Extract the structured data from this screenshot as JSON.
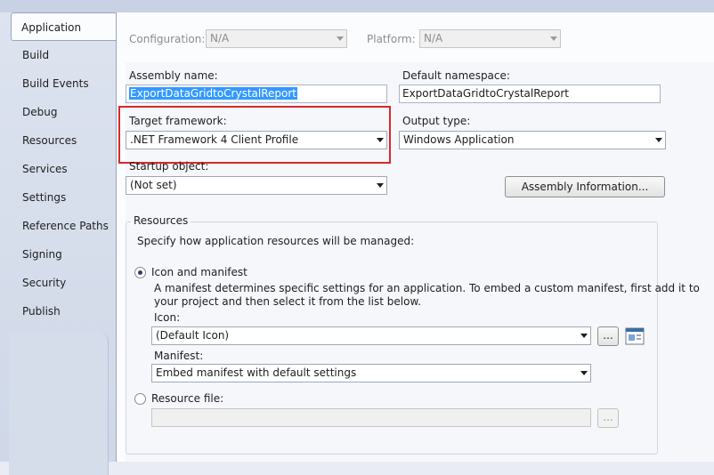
{
  "sidebar": {
    "tabs": [
      {
        "label": "Application",
        "active": true
      },
      {
        "label": "Build"
      },
      {
        "label": "Build Events"
      },
      {
        "label": "Debug"
      },
      {
        "label": "Resources"
      },
      {
        "label": "Services"
      },
      {
        "label": "Settings"
      },
      {
        "label": "Reference Paths"
      },
      {
        "label": "Signing"
      },
      {
        "label": "Security"
      },
      {
        "label": "Publish"
      }
    ]
  },
  "config": {
    "configuration_label": "Configuration:",
    "configuration_value": "N/A",
    "platform_label": "Platform:",
    "platform_value": "N/A"
  },
  "assembly": {
    "name_label": "Assembly name:",
    "name_value": "ExportDataGridtoCrystalReport",
    "namespace_label": "Default namespace:",
    "namespace_value": "ExportDataGridtoCrystalReport"
  },
  "framework": {
    "label": "Target framework:",
    "value": ".NET Framework 4 Client Profile",
    "highlight_color": "#d62a2a"
  },
  "output": {
    "label": "Output type:",
    "value": "Windows Application"
  },
  "startup": {
    "label": "Startup object:",
    "value": "(Not set)"
  },
  "assembly_info_button": "Assembly Information...",
  "resources": {
    "title": "Resources",
    "description": "Specify how application resources will be managed:",
    "icon_manifest_label": "Icon and manifest",
    "manifest_help_line1": "A manifest determines specific settings for an application. To embed a custom manifest, first add it to",
    "manifest_help_line2": "your project and then select it from the list below.",
    "icon_label": "Icon:",
    "icon_value": "(Default Icon)",
    "browse_label": "...",
    "manifest_label": "Manifest:",
    "manifest_value": "Embed manifest with default settings",
    "resource_file_label": "Resource file:",
    "resource_file_value": "",
    "resource_browse_label": "...",
    "selected_option": "Icon and manifest"
  }
}
